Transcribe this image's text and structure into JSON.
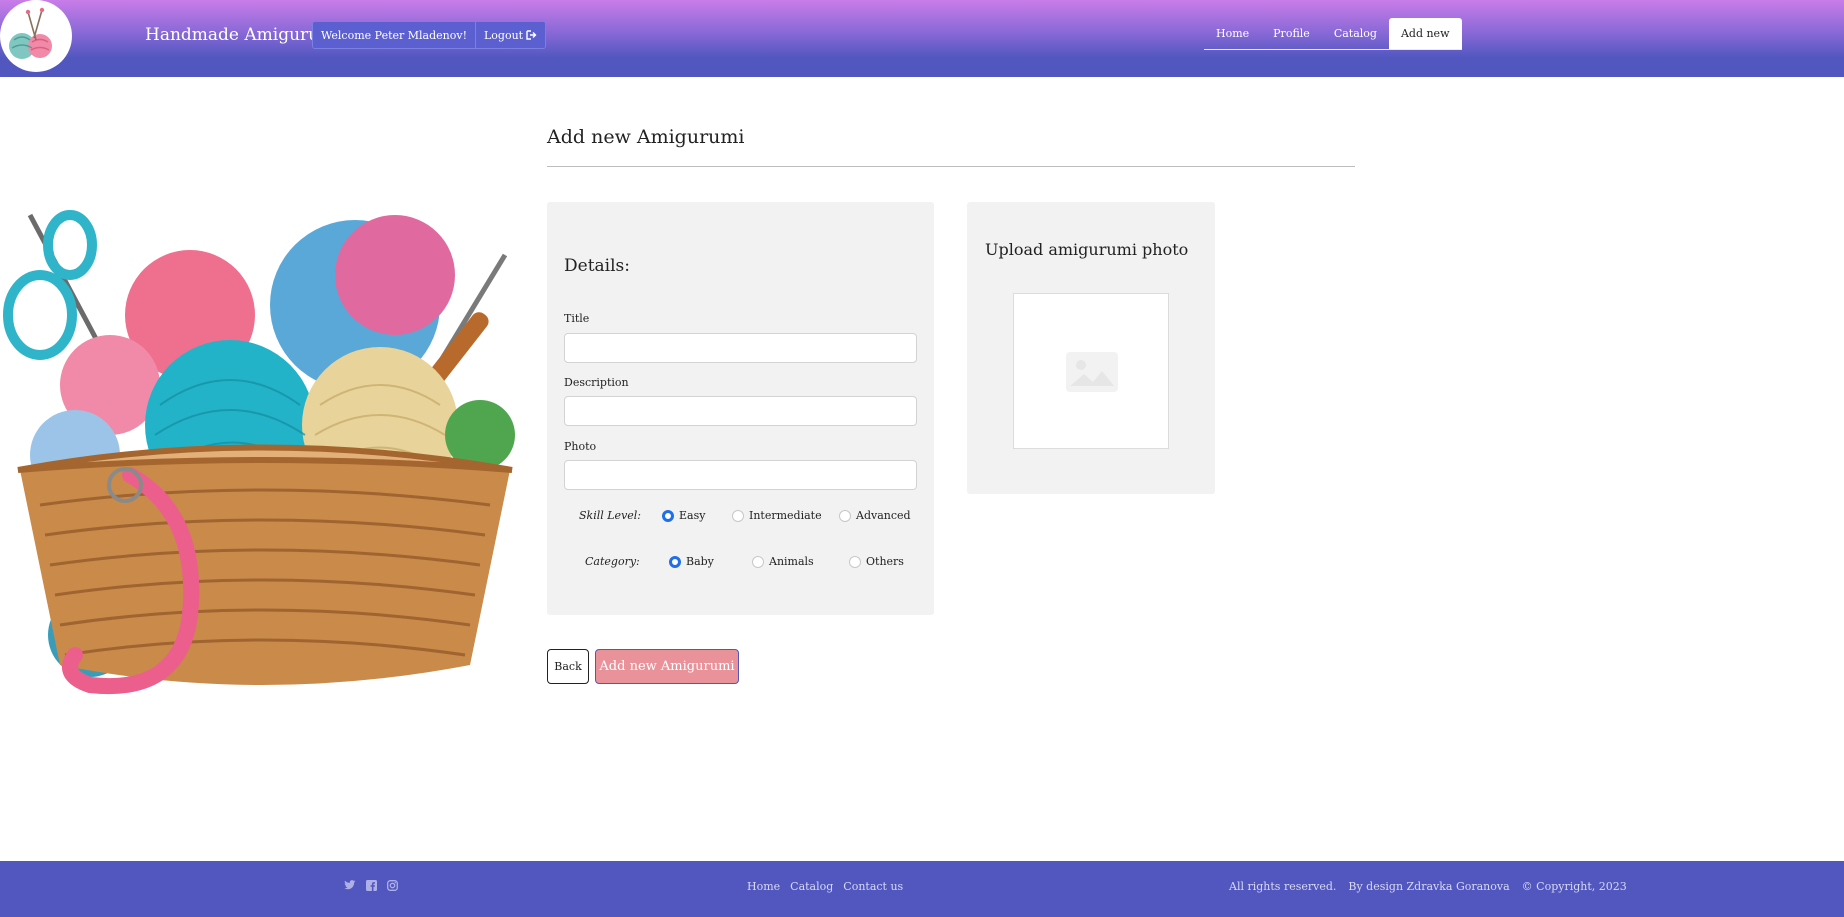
{
  "header": {
    "brand": "Handmade Amigurumi",
    "welcome": "Welcome Peter Mladenov!",
    "logout": "Logout",
    "nav": [
      "Home",
      "Profile",
      "Catalog",
      "Add new"
    ],
    "active_nav": "Add new"
  },
  "page": {
    "title": "Add new Amigurumi"
  },
  "details": {
    "heading": "Details:",
    "fields": [
      {
        "label": "Title",
        "value": ""
      },
      {
        "label": "Description",
        "value": ""
      },
      {
        "label": "Photo",
        "value": ""
      }
    ],
    "skill_level": {
      "label": "Skill Level:",
      "options": [
        "Easy",
        "Intermediate",
        "Advanced"
      ],
      "selected": "Easy"
    },
    "category": {
      "label": "Category:",
      "options": [
        "Baby",
        "Animals",
        "Others"
      ],
      "selected": "Baby"
    }
  },
  "upload": {
    "heading": "Upload amigurumi photo",
    "placeholder_icon": "image-placeholder-icon"
  },
  "buttons": {
    "back": "Back",
    "add": "Add new Amigurumi"
  },
  "footer": {
    "social_icons": [
      "twitter-icon",
      "facebook-icon",
      "instagram-icon"
    ],
    "links": [
      "Home",
      "Catalog",
      "Contact us"
    ],
    "rights": "All rights reserved.",
    "design": "By design Zdravka Goranova",
    "copyright": "© Copyright, 2023"
  },
  "colors": {
    "header_top": "#c97ce8",
    "header_bottom": "#5257c0",
    "panel_bg": "#f2f2f2",
    "add_button": "#ea929a",
    "radio_accent": "#1f6fe8",
    "footer_bg": "#5257c0"
  }
}
